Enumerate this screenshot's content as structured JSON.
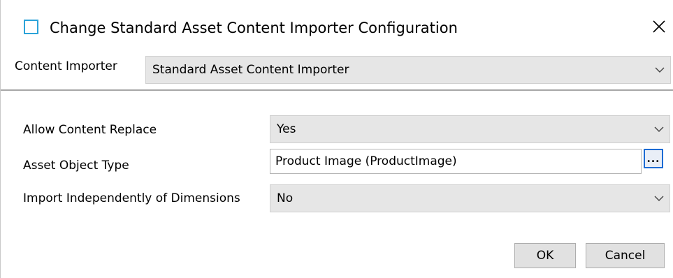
{
  "dialog": {
    "title": "Change Standard Asset Content Importer Configuration",
    "icon": "window-icon",
    "close_icon": "close-icon"
  },
  "importer": {
    "label": "Content Importer",
    "value": "Standard Asset Content Importer"
  },
  "fields": {
    "allow_content_replace": {
      "label": "Allow Content Replace",
      "value": "Yes"
    },
    "asset_object_type": {
      "label": "Asset Object Type",
      "value": "Product Image (ProductImage)",
      "browse_label": "..."
    },
    "import_independently": {
      "label": "Import Independently of Dimensions",
      "value": "No"
    }
  },
  "buttons": {
    "ok": "OK",
    "cancel": "Cancel"
  },
  "colors": {
    "icon_accent": "#2ba3d9",
    "combo_bg": "#e6e6e6",
    "focus_border": "#1c6bd4"
  }
}
